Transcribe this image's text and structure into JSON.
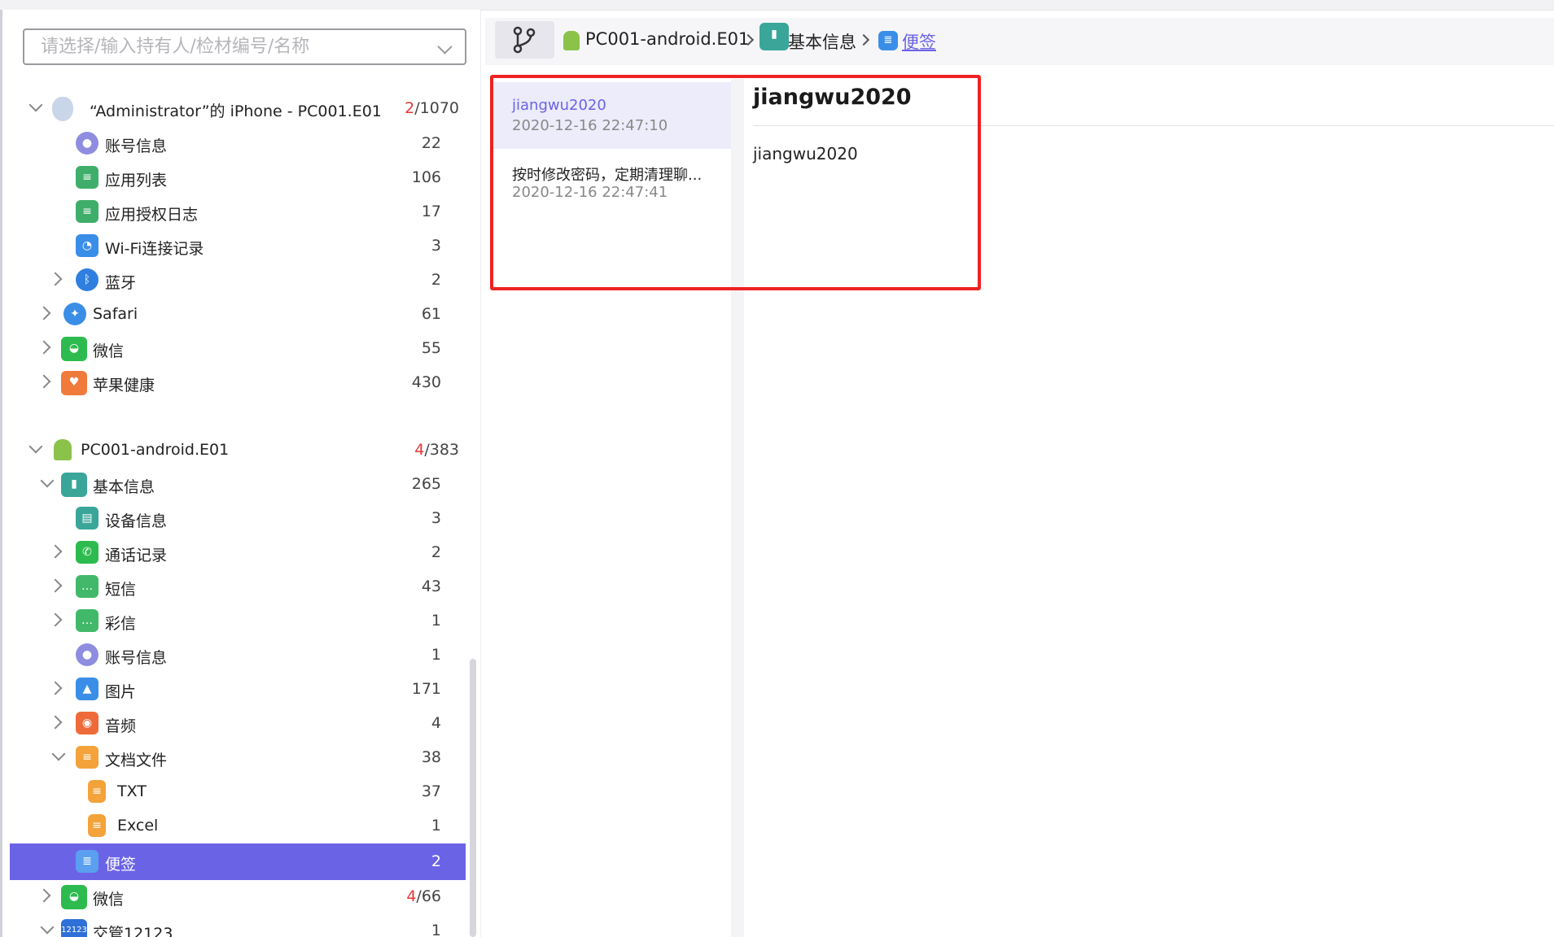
{
  "search": {
    "placeholder": "请选择/输入持有人/检材编号/名称"
  },
  "tree": {
    "iphone": {
      "title": "“Administrator”的 iPhone - PC001.E01",
      "count_red": "2",
      "count_rest": "/1070",
      "children": [
        {
          "label": "账号信息",
          "count": "22",
          "icon": "account-icon",
          "color": "#8f8de0"
        },
        {
          "label": "应用列表",
          "count": "106",
          "icon": "list-icon",
          "color": "#3fae6a"
        },
        {
          "label": "应用授权日志",
          "count": "17",
          "icon": "list-icon",
          "color": "#3fae6a"
        },
        {
          "label": "Wi-Fi连接记录",
          "count": "3",
          "icon": "wifi-icon",
          "color": "#3b8ee8"
        },
        {
          "label": "蓝牙",
          "count": "2",
          "icon": "bluetooth-icon",
          "color": "#2f7fe0"
        },
        {
          "label": "Safari",
          "count": "61",
          "icon": "safari-icon",
          "color": "#3a8ee6"
        },
        {
          "label": "微信",
          "count": "55",
          "icon": "wechat-icon",
          "color": "#2dbb4f"
        },
        {
          "label": "苹果健康",
          "count": "430",
          "icon": "health-icon",
          "color": "#f07a3a"
        }
      ]
    },
    "android": {
      "title": "PC001-android.E01",
      "count_red": "4",
      "count_rest": "/383",
      "children": [
        {
          "label": "基本信息",
          "count": "265",
          "icon": "phone-info-icon",
          "color": "#3aa69a"
        },
        {
          "label": "设备信息",
          "count": "3",
          "icon": "device-info-icon",
          "color": "#3aa69a"
        },
        {
          "label": "通话记录",
          "count": "2",
          "icon": "phone-call-icon",
          "color": "#2dbb4f"
        },
        {
          "label": "短信",
          "count": "43",
          "icon": "sms-icon",
          "color": "#42b96a"
        },
        {
          "label": "彩信",
          "count": "1",
          "icon": "mms-icon",
          "color": "#42b96a"
        },
        {
          "label": "账号信息",
          "count": "1",
          "icon": "account-icon",
          "color": "#8f8de0"
        },
        {
          "label": "图片",
          "count": "171",
          "icon": "image-icon",
          "color": "#3b8ee8"
        },
        {
          "label": "音频",
          "count": "4",
          "icon": "audio-icon",
          "color": "#ef6a3a"
        },
        {
          "label": "文档文件",
          "count": "38",
          "icon": "document-icon",
          "color": "#f3a33a"
        },
        {
          "label": "TXT",
          "count": "37",
          "icon": "document-icon",
          "color": "#f3a33a"
        },
        {
          "label": "Excel",
          "count": "1",
          "icon": "document-icon",
          "color": "#f3a33a"
        },
        {
          "label": "便签",
          "count": "2",
          "icon": "note-icon",
          "color": "#3b8ee8"
        },
        {
          "label": "微信",
          "count_red": "4",
          "count_rest": "/66",
          "icon": "wechat-icon",
          "color": "#2dbb4f"
        },
        {
          "label": "交管12123",
          "count": "1",
          "icon": "traffic-app-icon",
          "color": "#2f6fd8"
        }
      ]
    }
  },
  "breadcrumb": {
    "device": "PC001-android.E01",
    "category": "基本信息",
    "current": "便签"
  },
  "notes": [
    {
      "title": "jiangwu2020",
      "time": "2020-12-16 22:47:10"
    },
    {
      "title": "按时修改密码，定期清理聊...",
      "time": "2020-12-16 22:47:41"
    }
  ],
  "detail": {
    "title": "jiangwu2020",
    "body": "jiangwu2020"
  },
  "colors": {
    "accent": "#6b63e6",
    "highlight": "#ee2222",
    "red_count": "#e53935"
  }
}
